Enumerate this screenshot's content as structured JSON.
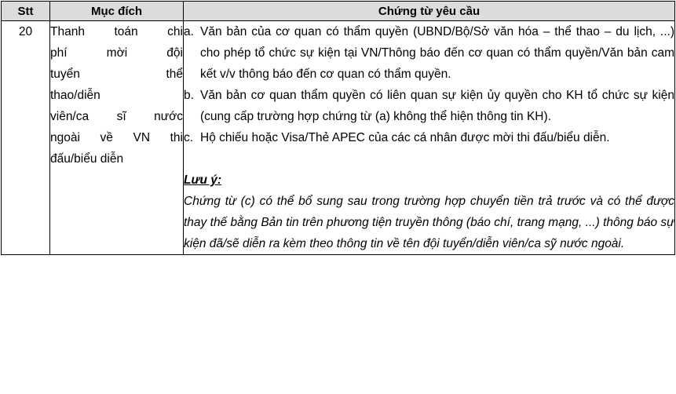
{
  "table": {
    "headers": {
      "stt": "Stt",
      "purpose": "Mục đích",
      "documents": "Chứng từ yêu cầu"
    },
    "row": {
      "stt": "20",
      "purpose_lines": [
        "Thanh toán chi",
        "phí mời đội",
        "tuyển thể",
        "thao/diễn",
        "viên/ca sĩ nước",
        "ngoài về VN thi",
        "đấu/biểu diễn"
      ],
      "items": [
        {
          "marker": "a.",
          "text": "Văn bản của cơ quan có thẩm quyền (UBND/Bộ/Sở văn hóa – thể thao – du lịch, ...) cho phép tổ chức sự kiện tại VN/Thông báo đến cơ quan có thẩm quyền/Văn bản cam kết v/v thông báo đến cơ quan có thẩm quyền."
        },
        {
          "marker": "b.",
          "text": "Văn bản cơ quan thẩm quyền có liên quan sự kiện ủy quyền cho KH tổ chức sự kiện (cung cấp trường hợp chứng từ (a) không thể hiện thông tin KH)."
        },
        {
          "marker": "c.",
          "text": "Hộ chiếu hoặc Visa/Thẻ APEC của các cá nhân được mời thi đấu/biểu diễn."
        }
      ],
      "note_title": "Lưu ý:",
      "note_text": "Chứng từ (c) có thể bổ sung sau trong trường hợp chuyển tiền trả trước và có thể được thay thế bằng Bản tin trên phương tiện truyền thông (báo chí, trang mạng, ...) thông báo sự kiện đã/sẽ diễn ra kèm theo thông tin về tên đội tuyển/diễn viên/ca sỹ nước ngoài."
    }
  }
}
